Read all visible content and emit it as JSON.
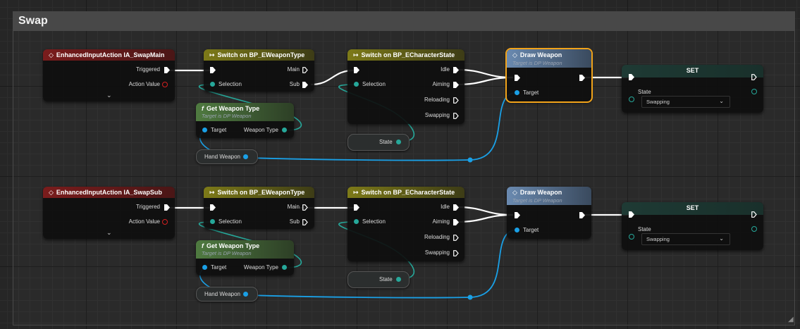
{
  "comment": {
    "title": "Swap"
  },
  "rows": [
    {
      "event": {
        "title": "EnhancedInputAction IA_SwapMain",
        "pin_triggered": "Triggered",
        "pin_action_value": "Action Value"
      },
      "switch_weapon": {
        "title": "Switch on BP_EWeaponType",
        "pin_selection": "Selection",
        "pin_main": "Main",
        "pin_sub": "Sub"
      },
      "get_weapon_type": {
        "title": "Get Weapon Type",
        "subtitle": "Target is DP Weapon",
        "pin_target": "Target",
        "pin_weapon_type": "Weapon Type"
      },
      "hand_weapon": {
        "label": "Hand Weapon"
      },
      "switch_state": {
        "title": "Switch on BP_ECharacterState",
        "pin_selection": "Selection",
        "pin_idle": "Idle",
        "pin_aiming": "Aiming",
        "pin_reloading": "Reloading",
        "pin_swapping": "Swapping"
      },
      "state_var": {
        "label": "State"
      },
      "draw_weapon": {
        "title": "Draw Weapon",
        "subtitle": "Target is DP Weapon",
        "pin_target": "Target",
        "selected": true
      },
      "set_node": {
        "title": "SET",
        "pin_state": "State",
        "state_value": "Swapping"
      }
    },
    {
      "event": {
        "title": "EnhancedInputAction IA_SwapSub",
        "pin_triggered": "Triggered",
        "pin_action_value": "Action Value"
      },
      "switch_weapon": {
        "title": "Switch on BP_EWeaponType",
        "pin_selection": "Selection",
        "pin_main": "Main",
        "pin_sub": "Sub"
      },
      "get_weapon_type": {
        "title": "Get Weapon Type",
        "subtitle": "Target is DP Weapon",
        "pin_target": "Target",
        "pin_weapon_type": "Weapon Type"
      },
      "hand_weapon": {
        "label": "Hand Weapon"
      },
      "switch_state": {
        "title": "Switch on BP_ECharacterState",
        "pin_selection": "Selection",
        "pin_idle": "Idle",
        "pin_aiming": "Aiming",
        "pin_reloading": "Reloading",
        "pin_swapping": "Swapping"
      },
      "state_var": {
        "label": "State"
      },
      "draw_weapon": {
        "title": "Draw Weapon",
        "subtitle": "Target is DP Weapon",
        "pin_target": "Target",
        "selected": false
      },
      "set_node": {
        "title": "SET",
        "pin_state": "State",
        "state_value": "Swapping"
      }
    }
  ],
  "colors": {
    "exec": "#ffffff",
    "enum_pin": "#26a89a",
    "object_pin": "#1aa0e6",
    "struct_pin": "#d32020",
    "selection": "#f1a31a"
  },
  "icons": {
    "event": "diamond-event-icon",
    "switch": "switch-icon",
    "function": "function-icon",
    "collapse": "chevron-down-icon"
  }
}
